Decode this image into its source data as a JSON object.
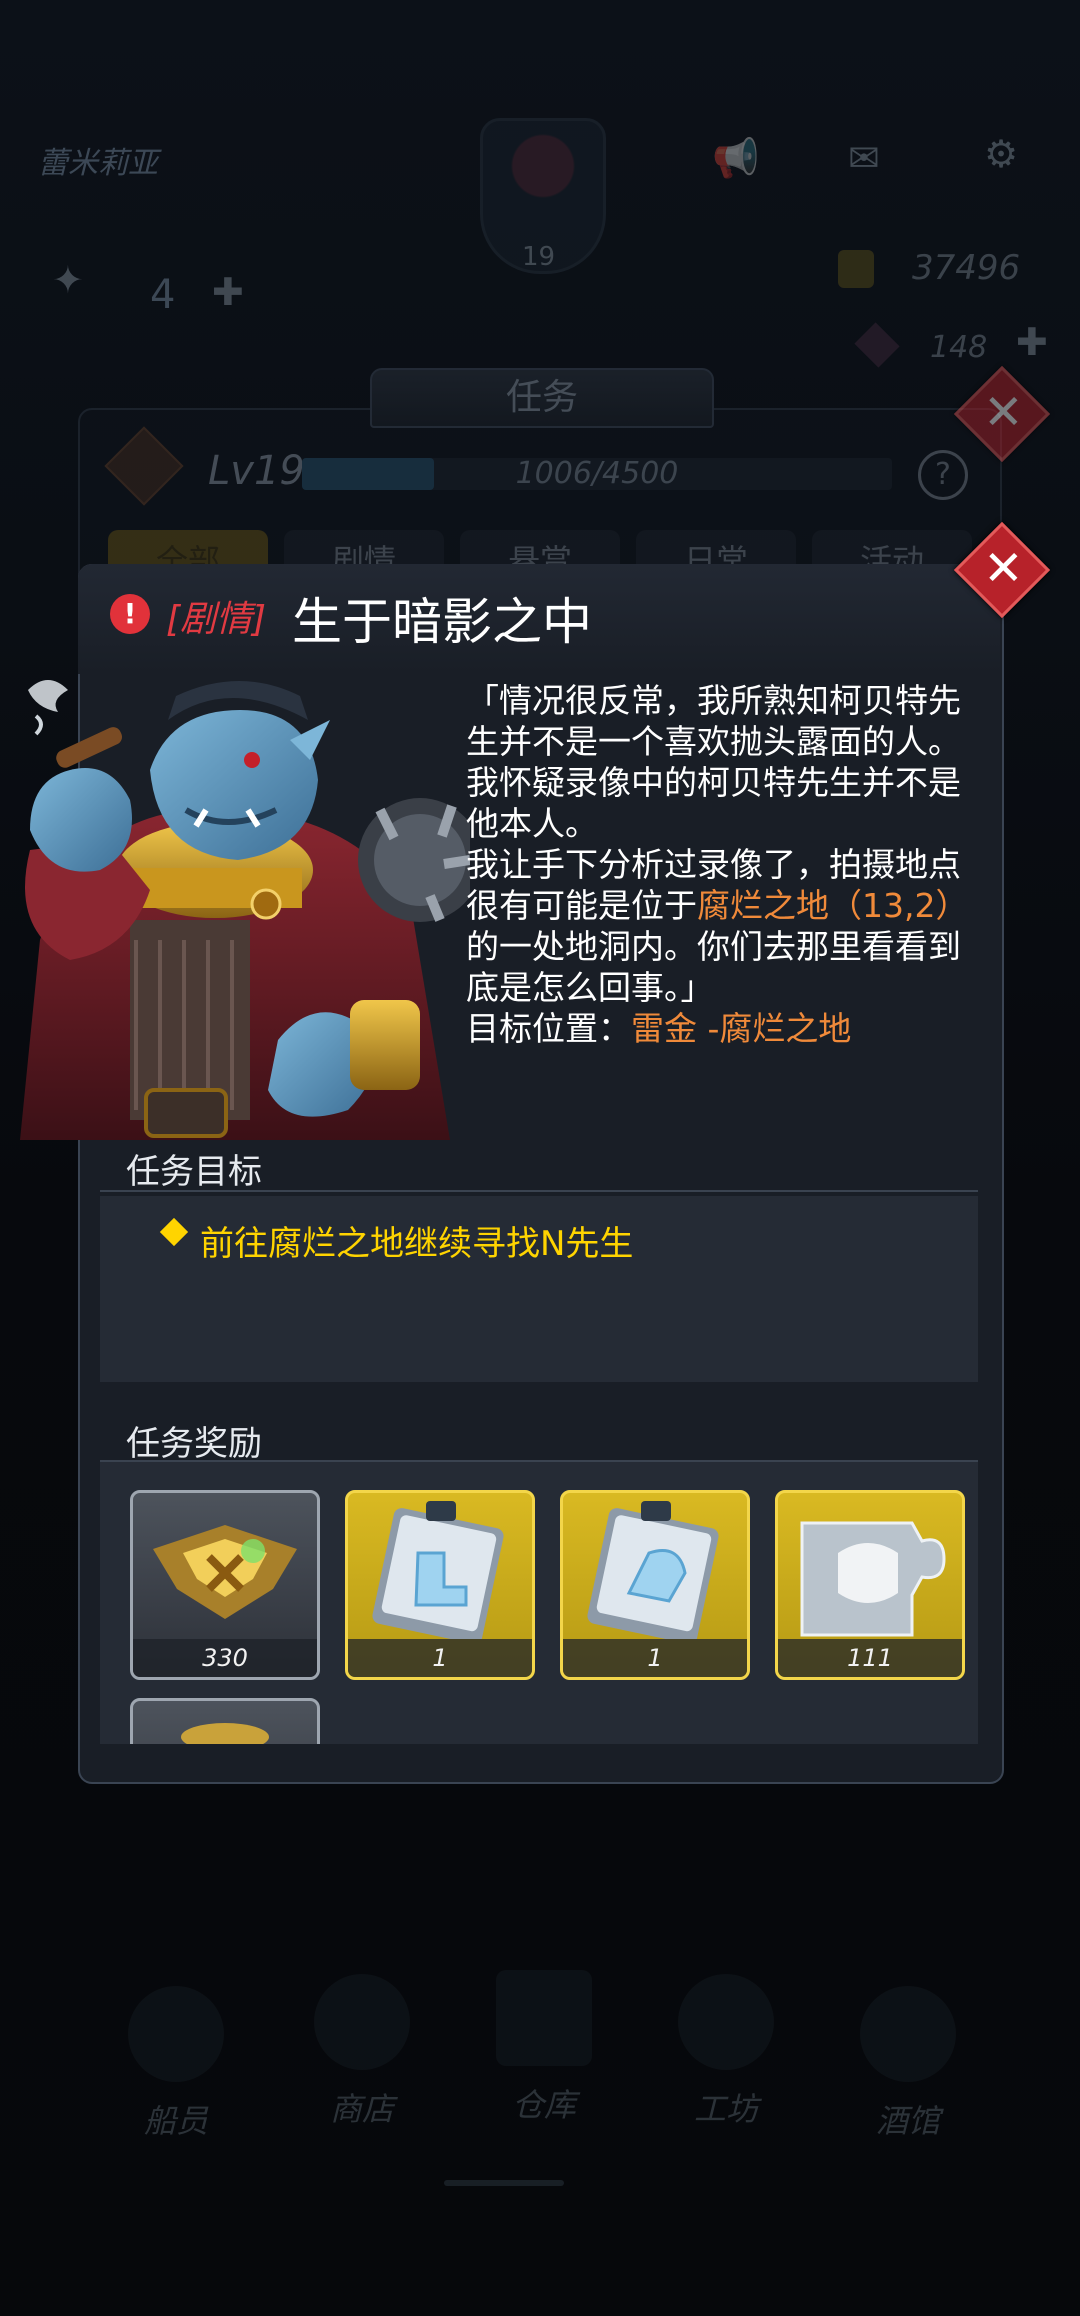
{
  "hud": {
    "player_name": "蕾米莉亚",
    "player_level": "19",
    "left_counter": "4",
    "gold": "37496",
    "gems": "148"
  },
  "nav": [
    {
      "label": "船员"
    },
    {
      "label": "商店"
    },
    {
      "label": "仓库"
    },
    {
      "label": "工坊"
    },
    {
      "label": "酒馆"
    }
  ],
  "back_panel": {
    "title": "任务",
    "level_label": "Lv19",
    "xp_text": "1006/4500",
    "xp_fraction": 0.2236,
    "help_glyph": "?",
    "tabs": [
      "全部",
      "剧情",
      "悬赏",
      "日常",
      "活动"
    ]
  },
  "dialog": {
    "close_glyph": "✕",
    "alert_glyph": "!",
    "tag": "[剧情]",
    "title": "生于暗影之中",
    "story_lines": [
      {
        "text": "「情况很反常，我所熟知柯贝特先"
      },
      {
        "text": "生并不是一个喜欢抛头露面的人。"
      },
      {
        "text": "我怀疑录像中的柯贝特先生并不是"
      },
      {
        "text": "他本人。"
      },
      {
        "text": "我让手下分析过录像了，拍摄地点"
      },
      {
        "text": "很有可能是位于",
        "highlight": "腐烂之地（13,2）"
      },
      {
        "text": "的一处地洞内。你们去那里看看到"
      },
      {
        "text": "底是怎么回事。」"
      },
      {
        "text": "目标位置：",
        "highlight": "雷金 -腐烂之地"
      }
    ],
    "objective_title": "任务目标",
    "objective_text": "前往腐烂之地继续寻找N先生",
    "rewards_title": "任务奖励",
    "rewards": [
      {
        "name": "exp-badge",
        "qty": "330",
        "frame": "silver"
      },
      {
        "name": "boots-blueprint",
        "qty": "1",
        "frame": "gold"
      },
      {
        "name": "gauntlet-blueprint",
        "qty": "1",
        "frame": "gold"
      },
      {
        "name": "armor-fragment",
        "qty": "111",
        "frame": "gold"
      },
      {
        "name": "partial-reward",
        "qty": "",
        "frame": "silver"
      }
    ]
  },
  "colors": {
    "accent_orange": "#f08a3a",
    "objective_yellow": "#ffd400",
    "story_red": "#e13a42",
    "close_red": "#b7222a"
  }
}
